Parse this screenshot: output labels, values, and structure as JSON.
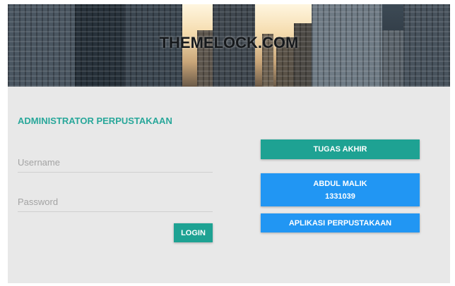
{
  "banner": {
    "watermark": "THEMELOCK.COM"
  },
  "form": {
    "title": "ADMINISTRATOR PERPUSTAKAAN",
    "username_placeholder": "Username",
    "password_placeholder": "Password",
    "login_label": "LOGIN"
  },
  "info": {
    "tugas_label": "TUGAS AKHIR",
    "name": "ABDUL MALIK",
    "nim": "1331039",
    "aplikasi_label": "APLIKASI PERPUSTAKAAN"
  },
  "colors": {
    "accent_teal": "#1ea293",
    "title_teal": "#28a79a",
    "accent_blue": "#2196f3",
    "panel_bg": "#e8e8e8"
  }
}
